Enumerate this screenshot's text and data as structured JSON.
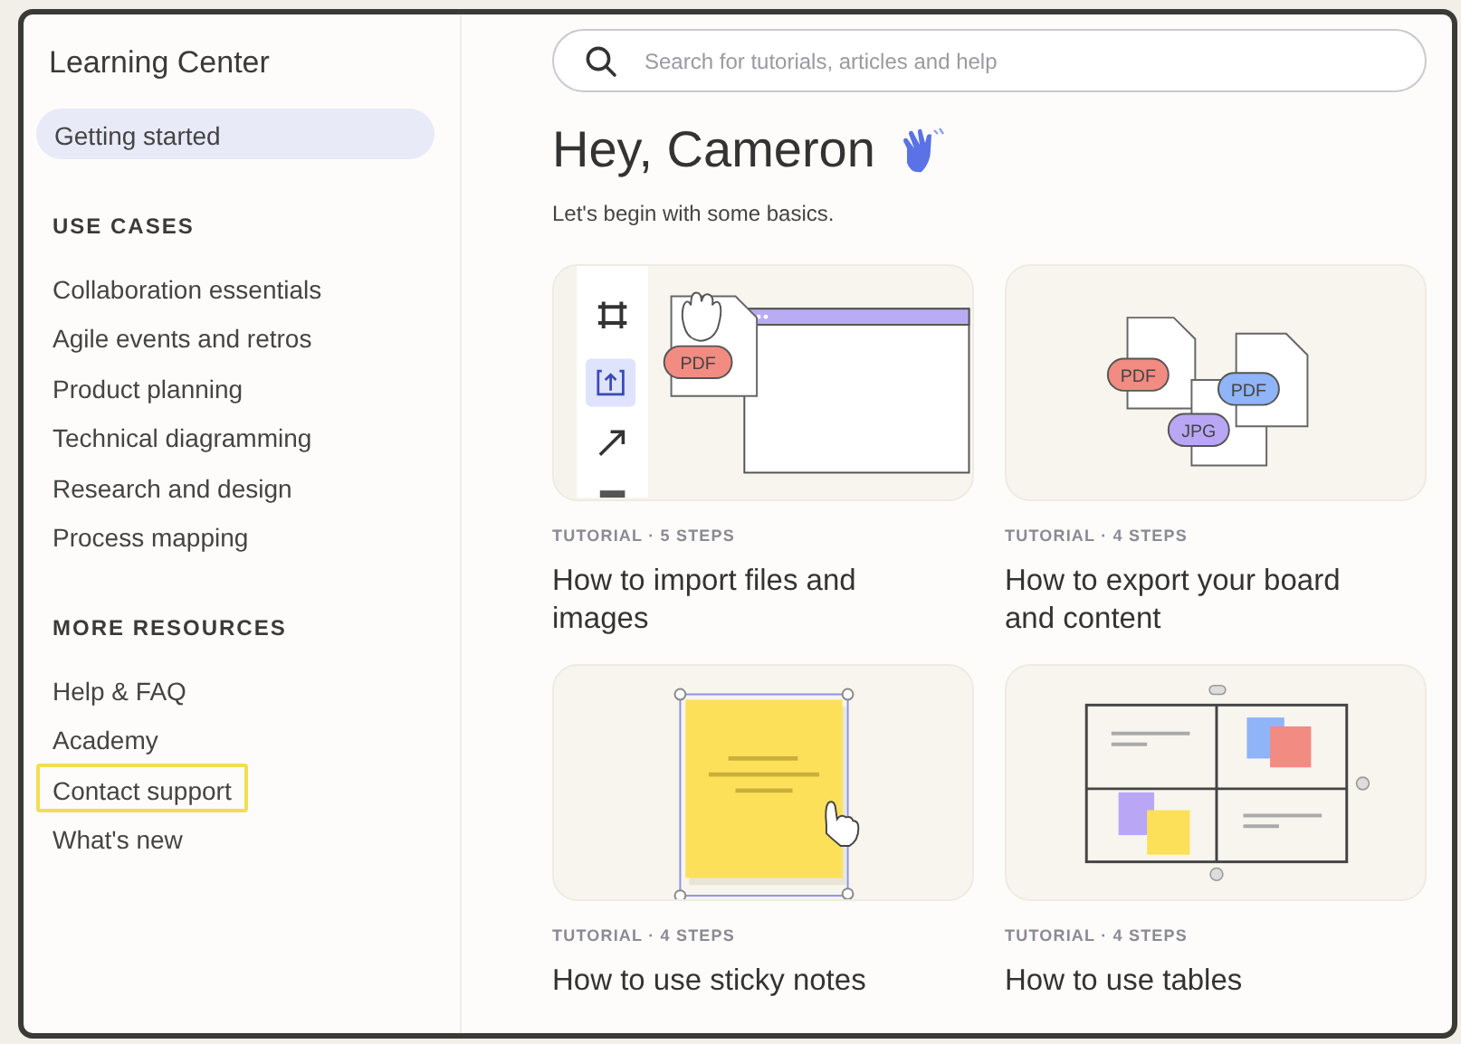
{
  "sidebar": {
    "title": "Learning Center",
    "nav": [
      {
        "label": "Getting started",
        "selected": true,
        "focused": false
      }
    ],
    "sections": [
      {
        "heading": "USE CASES",
        "items": [
          {
            "label": "Collaboration essentials",
            "selected": false,
            "focused": false
          },
          {
            "label": "Agile events and retros",
            "selected": false,
            "focused": false
          },
          {
            "label": "Product planning",
            "selected": false,
            "focused": false
          },
          {
            "label": "Technical diagramming",
            "selected": false,
            "focused": false
          },
          {
            "label": "Research and design",
            "selected": false,
            "focused": false
          },
          {
            "label": "Process mapping",
            "selected": false,
            "focused": false
          }
        ]
      },
      {
        "heading": "MORE RESOURCES",
        "items": [
          {
            "label": "Help & FAQ",
            "selected": false,
            "focused": false
          },
          {
            "label": "Academy",
            "selected": false,
            "focused": false
          },
          {
            "label": "Contact support",
            "selected": false,
            "focused": true
          },
          {
            "label": "What's new",
            "selected": false,
            "focused": false
          }
        ]
      }
    ]
  },
  "search": {
    "placeholder": "Search for tutorials, articles and help"
  },
  "greeting": {
    "title": "Hey, Cameron",
    "subtitle": "Let's begin with some basics."
  },
  "tutorials": [
    {
      "kind": "import",
      "meta": "TUTORIAL · 5 STEPS",
      "title": "How to import files and images",
      "tags": [
        {
          "text": "PDF",
          "color": "#f28b82"
        }
      ]
    },
    {
      "kind": "export",
      "meta": "TUTORIAL · 4 STEPS",
      "title": "How to export your board and content",
      "tags": [
        {
          "text": "PDF",
          "color": "#f28b82"
        },
        {
          "text": "PDF",
          "color": "#8fb4f7"
        },
        {
          "text": "JPG",
          "color": "#b9a7f5"
        }
      ]
    },
    {
      "kind": "sticky",
      "meta": "TUTORIAL · 4 STEPS",
      "title": "How to use sticky notes"
    },
    {
      "kind": "table",
      "meta": "TUTORIAL · 4 STEPS",
      "title": "How to use tables"
    }
  ]
}
